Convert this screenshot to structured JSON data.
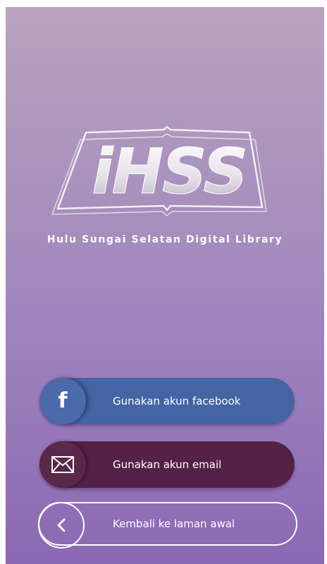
{
  "logo": {
    "text": "iHSS",
    "subtitle": "Hulu Sungai Selatan Digital Library"
  },
  "buttons": {
    "facebook": {
      "label": "Gunakan akun facebook",
      "icon": "facebook-icon"
    },
    "email": {
      "label": "Gunakan akun email",
      "icon": "envelope-icon"
    },
    "back": {
      "label": "Kembali ke laman awal",
      "icon": "chevron-left-icon"
    }
  },
  "colors": {
    "background_top": "#b9a3bd",
    "background_bottom": "#8b68b3",
    "facebook": "#4464a4",
    "email": "#542246",
    "text": "#ffffff"
  }
}
